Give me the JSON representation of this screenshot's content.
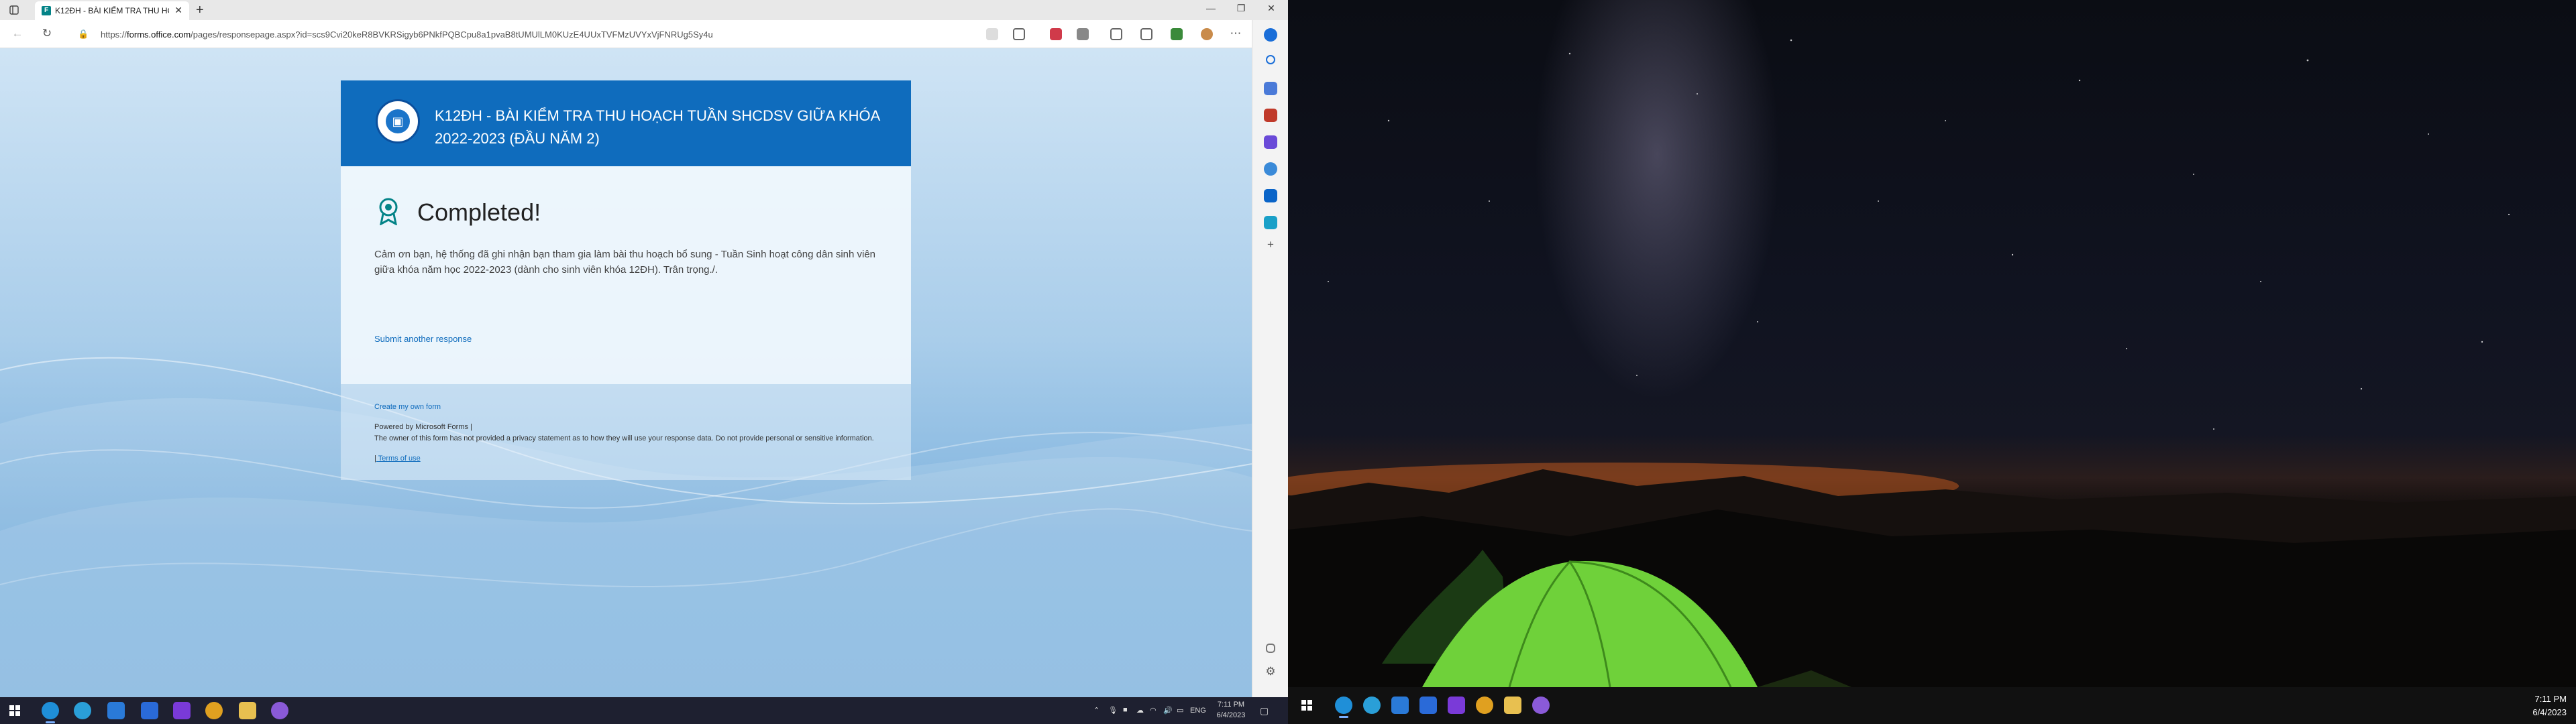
{
  "browser": {
    "tab_title": "K12ĐH - BÀI KIỂM TRA THU HOẠ",
    "url_prefix": "https://",
    "url_domain": "forms.office.com",
    "url_rest": "/pages/responsepage.aspx?id=scs9Cvi20keR8BVKRSigyb6PNkfPQBCpu8a1pvaB8tUMUlLM0KUzE4UUxTVFMzUVYxVjFNRUg5Sy4u"
  },
  "form": {
    "title": "K12ĐH - BÀI KIỂM TRA THU HOẠCH TUẦN SHCDSV GIỮA KHÓA 2022-2023 (ĐẦU NĂM 2)",
    "status": "Completed!",
    "message": "Cảm ơn bạn, hệ thống đã ghi nhận bạn tham gia làm bài thu hoạch bổ sung - Tuần Sinh hoạt công dân sinh viên giữa khóa năm học 2022-2023 (dành cho sinh viên khóa 12ĐH). Trân trọng./.",
    "submit_another": "Submit another response",
    "create_own": "Create my own form",
    "powered_by": "Powered by Microsoft Forms |",
    "owner_notice": "The owner of this form has not provided a privacy statement as to how they will use your response data. Do not provide personal or sensitive information.",
    "terms_prefix": "|",
    "terms": "Terms of use"
  },
  "taskbar_left": {
    "time": "7:11 PM",
    "date": "6/4/2023",
    "lang": "ENG"
  },
  "taskbar_right": {
    "time": "7:11 PM",
    "date": "6/4/2023"
  },
  "colors": {
    "form_header": "#0f6cbd",
    "link": "#0f6cbd",
    "tent": "#6fd13a"
  }
}
